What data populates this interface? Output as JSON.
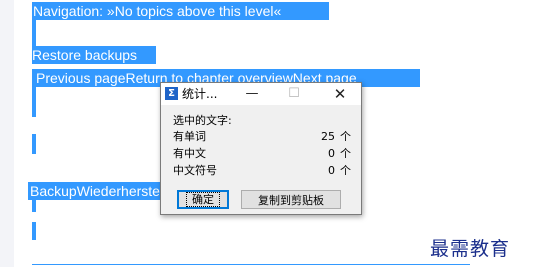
{
  "document": {
    "navigation_line": "Navigation:  »No topics above this level«",
    "heading_restore": "Restore backups",
    "nav_links": "Previous pageReturn to chapter overviewNext page",
    "heading_backup": "BackupWiederherstellung"
  },
  "dialog": {
    "title": "统计...",
    "minimize_glyph": "—",
    "maximize_glyph": "☐",
    "close_glyph": "✕",
    "header": "选中的文字:",
    "stats": [
      {
        "label": "有单词",
        "value": "25",
        "unit": "个"
      },
      {
        "label": "有中文",
        "value": "0",
        "unit": "个"
      },
      {
        "label": "中文符号",
        "value": "0",
        "unit": "个"
      }
    ],
    "ok_label": "确定",
    "copy_label": "复制到剪贴板"
  },
  "watermark": "最需教育",
  "colors": {
    "selection": "#3399ff",
    "dialog_bg": "#f0f0f0",
    "watermark": "#1b2f8c"
  },
  "icons": {
    "app_icon": "sigma-icon"
  }
}
